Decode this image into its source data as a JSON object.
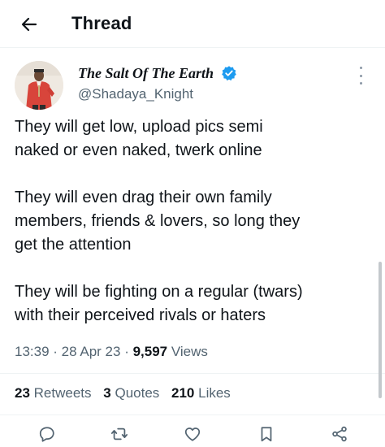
{
  "header": {
    "title": "Thread",
    "back_icon": "arrow-left-icon"
  },
  "author": {
    "display_name": "The Salt Of The Earth",
    "handle": "@Shadaya_Knight",
    "verified_color": "#1d9bf0"
  },
  "tweet": {
    "paragraphs": [
      "They will get low, upload pics semi\nnaked or even naked, twerk online",
      "They will even drag their own family\nmembers, friends & lovers, so long they\nget the attention",
      "They will be fighting on a regular (twars)\nwith their perceived rivals or haters"
    ],
    "time": "13:39",
    "date": "28 Apr 23",
    "views_count": "9,597",
    "views_label": "Views"
  },
  "stats": {
    "retweets_count": "23",
    "retweets_label": "Retweets",
    "quotes_count": "3",
    "quotes_label": "Quotes",
    "likes_count": "210",
    "likes_label": "Likes"
  },
  "actions": [
    "reply-icon",
    "retweet-icon",
    "like-icon",
    "bookmark-icon",
    "share-icon"
  ],
  "colors": {
    "text": "#0f1419",
    "secondary": "#536471",
    "brand": "#1d9bf0"
  }
}
